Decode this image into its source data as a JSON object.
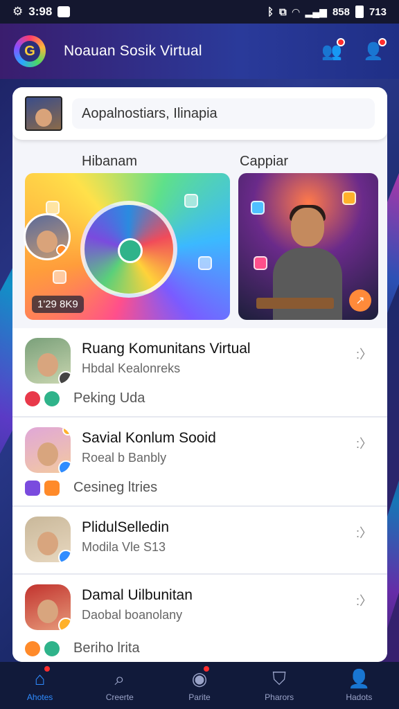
{
  "status_bar": {
    "time": "3:98",
    "right_text": "858",
    "battery": "713",
    "icons": [
      "gear-icon",
      "image-icon",
      "bluetooth-icon",
      "vibrate-icon",
      "wifi-icon",
      "signal-icon",
      "battery-icon"
    ]
  },
  "header": {
    "title": "Noauan Sosik Virtual",
    "logo_letter": "G",
    "actions": [
      "group-icon",
      "profile-icon"
    ]
  },
  "composer": {
    "placeholder": "Aopalnostiars, Ilinapia"
  },
  "stories": [
    {
      "label": "Hibanam",
      "count": "1'29 8K9"
    },
    {
      "label": "Cappiar"
    }
  ],
  "communities": [
    {
      "title": "Ruang Komunitans Virtual",
      "subtitle": "Hbdal Kealonreks",
      "meta": "Peking Uda",
      "colors": [
        "#e8394a",
        "#2fb38a"
      ]
    },
    {
      "title": "Savial Konlum Sooid",
      "subtitle": "Roeal b Banbly",
      "meta": "Cesineg ltries",
      "colors": [
        "#7a4bde",
        "#ff8a2a"
      ]
    },
    {
      "title": "PlidulSelledin",
      "subtitle": "Modila Vle S13",
      "meta": "",
      "colors": []
    },
    {
      "title": "Damal Uilbunitan",
      "subtitle": "Daobal boanolany",
      "meta": "Beriho lrita",
      "colors": [
        "#ff8a2a",
        "#2fb38a"
      ]
    }
  ],
  "bottom_nav": [
    {
      "label": "Ahotes",
      "icon": "home-icon",
      "glyph": "⌂",
      "active": true
    },
    {
      "label": "Creerte",
      "icon": "search-icon",
      "glyph": "⌕"
    },
    {
      "label": "Parite",
      "icon": "app-icon",
      "glyph": "◉"
    },
    {
      "label": "Pharors",
      "icon": "shield-icon",
      "glyph": "⛉"
    },
    {
      "label": "Hadots",
      "icon": "profile-icon",
      "glyph": "👤"
    }
  ],
  "colors": {
    "accent": "#2f8cff",
    "badge": "#ff2d2d",
    "header_bg": "#2a3a9a"
  }
}
